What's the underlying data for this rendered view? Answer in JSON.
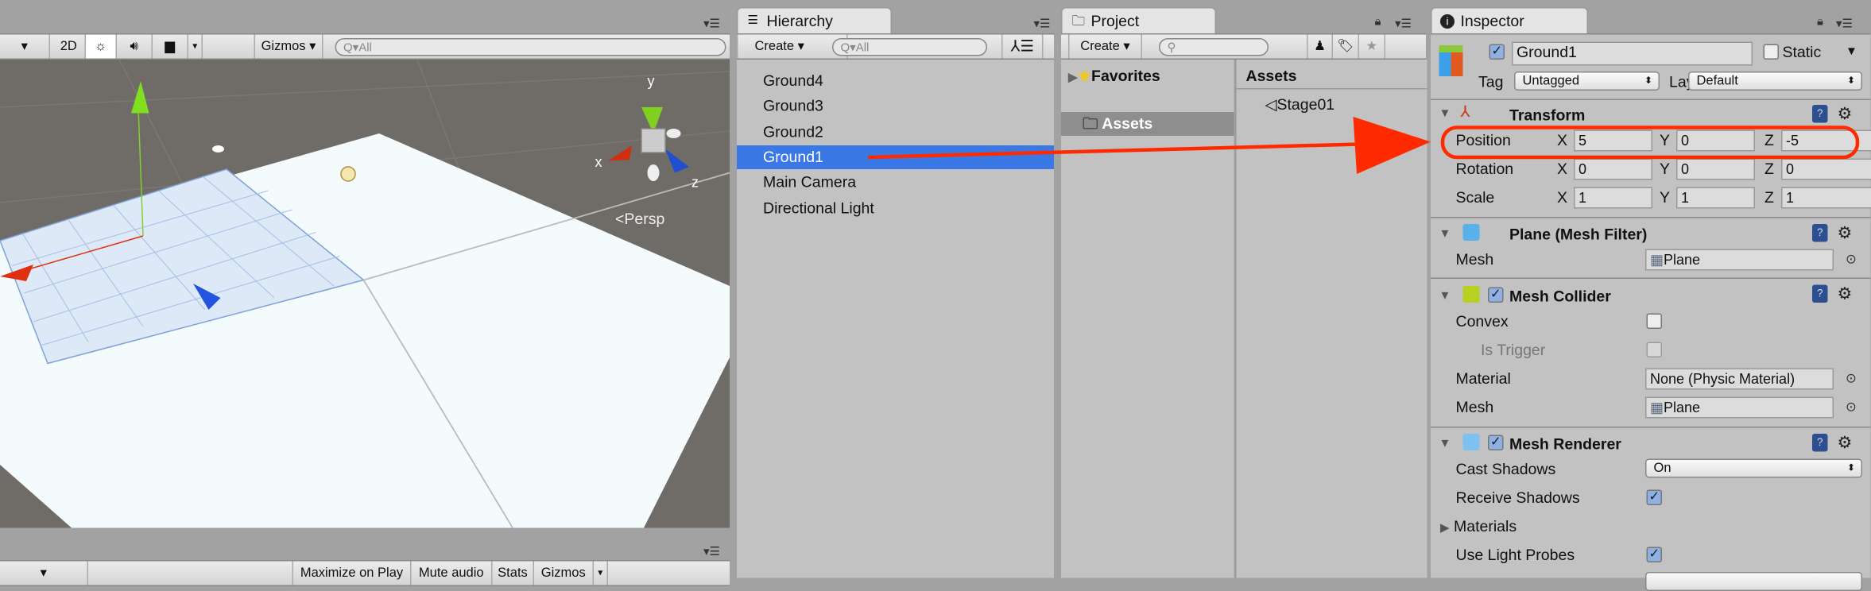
{
  "scene": {
    "toolbar": {
      "mode_2d": "2D",
      "gizmos": "Gizmos",
      "search_placeholder": "All"
    },
    "persp_label": "Persp",
    "axis_labels": {
      "x": "x",
      "y": "y",
      "z": "z"
    }
  },
  "game": {
    "toolbar": {
      "maximize_on_play": "Maximize on Play",
      "mute_audio": "Mute audio",
      "stats": "Stats",
      "gizmos": "Gizmos"
    }
  },
  "hierarchy": {
    "tab": "Hierarchy",
    "create": "Create",
    "search_placeholder": "All",
    "items": [
      {
        "label": "Ground4",
        "selected": false
      },
      {
        "label": "Ground3",
        "selected": false
      },
      {
        "label": "Ground2",
        "selected": false
      },
      {
        "label": "Ground1",
        "selected": true
      },
      {
        "label": "Main Camera",
        "selected": false
      },
      {
        "label": "Directional Light",
        "selected": false
      }
    ]
  },
  "project": {
    "tab": "Project",
    "create": "Create",
    "favorites": "Favorites",
    "assets_folder": "Assets",
    "assets_header": "Assets",
    "asset_items": [
      "Stage01"
    ]
  },
  "inspector": {
    "tab": "Inspector",
    "object_name": "Ground1",
    "active": true,
    "static_label": "Static",
    "static": false,
    "tag_label": "Tag",
    "tag_value": "Untagged",
    "layer_label": "Layer",
    "layer_value": "Default",
    "transform": {
      "title": "Transform",
      "position": {
        "label": "Position",
        "x": "5",
        "y": "0",
        "z": "-5"
      },
      "rotation": {
        "label": "Rotation",
        "x": "0",
        "y": "0",
        "z": "0"
      },
      "scale": {
        "label": "Scale",
        "x": "1",
        "y": "1",
        "z": "1"
      },
      "axis": {
        "x": "X",
        "y": "Y",
        "z": "Z"
      }
    },
    "mesh_filter": {
      "title": "Plane (Mesh Filter)",
      "mesh_label": "Mesh",
      "mesh_value": "Plane"
    },
    "mesh_collider": {
      "title": "Mesh Collider",
      "enabled": true,
      "convex_label": "Convex",
      "convex": false,
      "is_trigger_label": "Is Trigger",
      "is_trigger": false,
      "material_label": "Material",
      "material_value": "None (Physic Material)",
      "mesh_label": "Mesh",
      "mesh_value": "Plane"
    },
    "mesh_renderer": {
      "title": "Mesh Renderer",
      "enabled": true,
      "cast_shadows_label": "Cast Shadows",
      "cast_shadows_value": "On",
      "receive_shadows_label": "Receive Shadows",
      "receive_shadows": true,
      "materials_label": "Materials",
      "use_light_probes_label": "Use Light Probes",
      "use_light_probes": true
    }
  },
  "annotation": {
    "color": "#ff2a00"
  },
  "colors": {
    "selection": "#3a78e6",
    "scene_bg": "#6f6b66"
  }
}
